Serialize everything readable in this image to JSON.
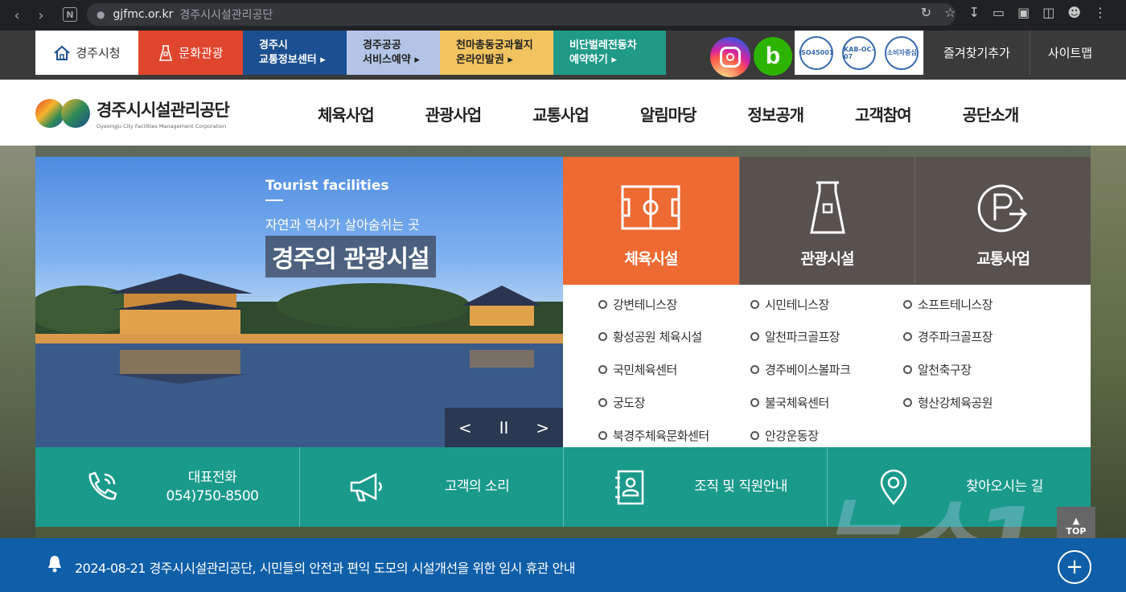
{
  "browser": {
    "domain": "gjfmc.or.kr",
    "page_title": "경주시시설관리공단"
  },
  "quicklinks": {
    "city": "경주시청",
    "culture": "문화관광",
    "traffic_line1": "경주시",
    "traffic_line2": "교통정보센터",
    "service_line1": "경주공공",
    "service_line2": "서비스예약",
    "cheonma_line1": "천마총동궁과월지",
    "cheonma_line2": "온라인발권",
    "vehicle_line1": "비단벌레전동차",
    "vehicle_line2": "예약하기",
    "certs": [
      "ISO45001",
      "KAB-OC-07",
      "소비자중심"
    ],
    "bookmark": "즐겨찾기추가",
    "sitemap": "사이트맵"
  },
  "header": {
    "logo_ko": "경주시시설관리공단",
    "logo_en": "Gyeongju City Facilities Management Corporation",
    "nav": [
      "체육사업",
      "관광사업",
      "교통사업",
      "알림마당",
      "정보공개",
      "고객참여",
      "공단소개"
    ]
  },
  "slide": {
    "sub_en": "Tourist facilities",
    "sub_ko": "자연과 역사가 살아숨쉬는 곳",
    "title": "경주의 관광시설",
    "prev": "<",
    "pause": "II",
    "next": ">"
  },
  "categories": [
    {
      "label": "체육시설",
      "icon": "field-icon",
      "active": true
    },
    {
      "label": "관광시설",
      "icon": "cheomseongdae-icon",
      "active": false
    },
    {
      "label": "교통사업",
      "icon": "parking-icon",
      "active": false
    }
  ],
  "facilities": [
    "강변테니스장",
    "시민테니스장",
    "소프트테니스장",
    "황성공원 체육시설",
    "알천파크골프장",
    "경주파크골프장",
    "국민체육센터",
    "경주베이스볼파크",
    "알천축구장",
    "궁도장",
    "불국체육센터",
    "형산강체육공원",
    "북경주체육문화센터",
    "안강운동장"
  ],
  "info": {
    "phone_label": "대표전화",
    "phone_number": "054)750-8500",
    "voice": "고객의 소리",
    "org": "조직 및 직원안내",
    "directions": "찾아오시는 길"
  },
  "notice": {
    "text": "2024-08-21  경주시시설관리공단, 시민들의 안전과 편익 도모의 시설개선을 위한 임시 휴관 안내",
    "top": "TOP"
  },
  "colors": {
    "accent_orange": "#ee6a33",
    "teal": "#1a9a8b",
    "notice_blue": "#0f5ea8"
  }
}
